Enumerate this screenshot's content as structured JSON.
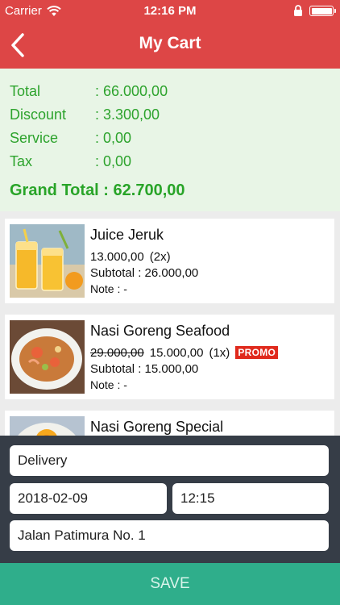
{
  "status_bar": {
    "carrier": "Carrier",
    "time": "12:16 PM",
    "icons": [
      "wifi-icon",
      "lock-rotation-icon",
      "battery-icon"
    ]
  },
  "nav": {
    "back_icon": "chevron-left-icon",
    "title": "My Cart"
  },
  "summary": {
    "rows": [
      {
        "label": "Total",
        "value": ": 66.000,00"
      },
      {
        "label": "Discount",
        "value": ": 3.300,00"
      },
      {
        "label": "Service",
        "value": ": 0,00"
      },
      {
        "label": "Tax",
        "value": ": 0,00"
      }
    ],
    "grand_total": "Grand Total : 62.700,00"
  },
  "cart_items": [
    {
      "name": "Juice Jeruk",
      "price": "13.000,00",
      "qty": "(2x)",
      "subtotal": "Subtotal : 26.000,00",
      "note": "Note : -"
    },
    {
      "name": "Nasi Goreng Seafood",
      "old_price": "29.000,00",
      "price": "15.000,00",
      "qty": "(1x)",
      "badge": "PROMO",
      "subtotal": "Subtotal : 15.000,00",
      "note": "Note : -"
    },
    {
      "name": "Nasi Goreng Special"
    }
  ],
  "form": {
    "delivery_type": "Delivery",
    "date": "2018-02-09",
    "time": "12:15",
    "address": "Jalan Patimura No. 1"
  },
  "save_label": "SAVE",
  "colors": {
    "header": "#dd4646",
    "summary_bg": "#e8f5e6",
    "summary_text": "#2da32d",
    "panel": "#363d47",
    "save": "#2fae8b",
    "promo": "#e02a1d"
  }
}
